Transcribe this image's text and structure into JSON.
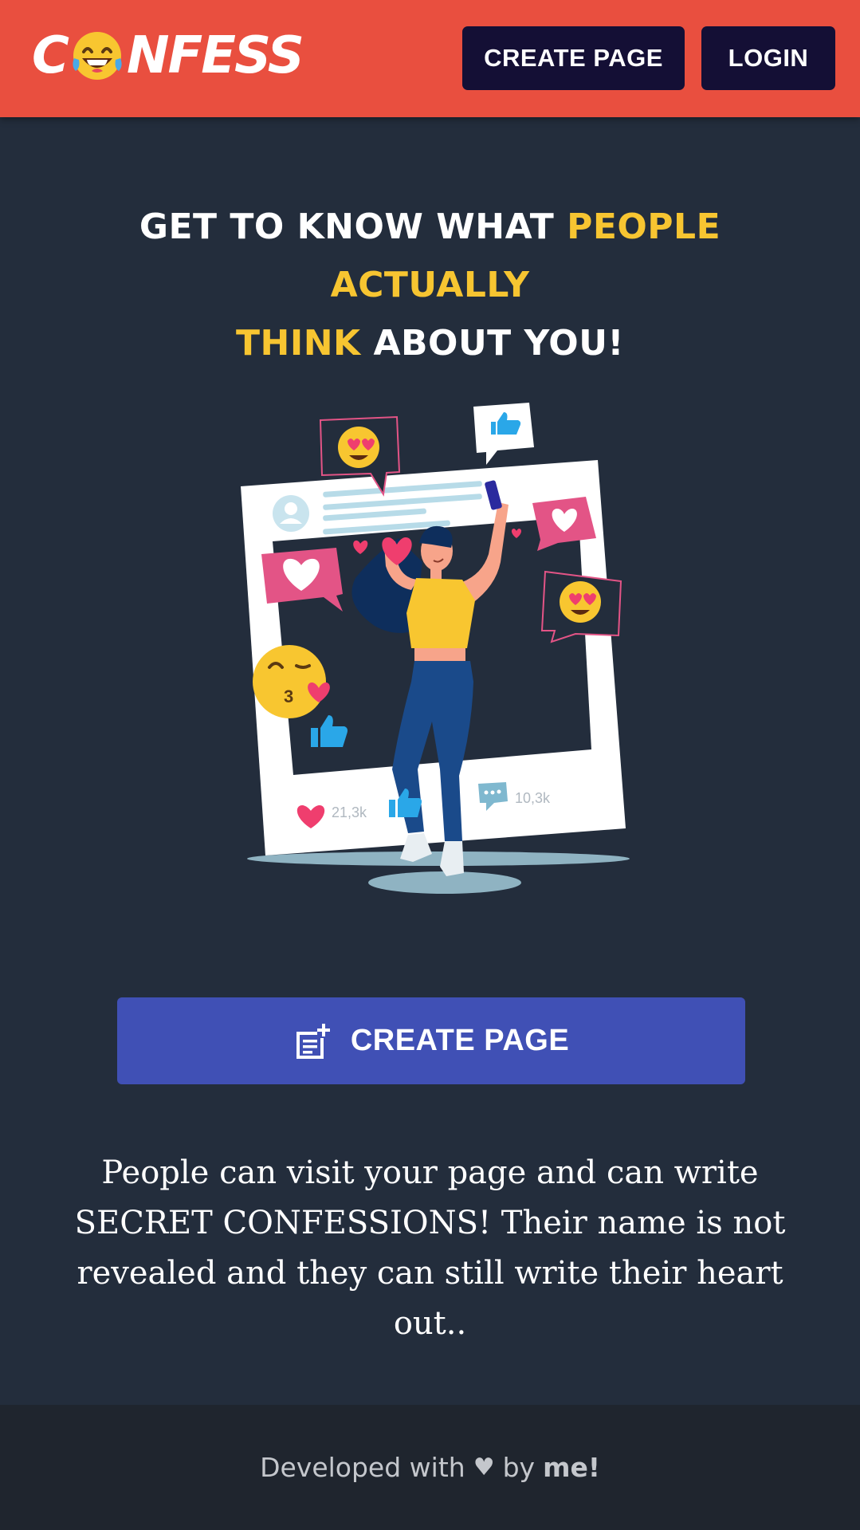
{
  "header": {
    "logo": {
      "text_start": "C",
      "text_end": "NFESS",
      "emoji": "laughing-face-icon"
    },
    "create_page_label": "CREATE PAGE",
    "login_label": "LOGIN"
  },
  "hero": {
    "headline_part1": "GET TO KNOW WHAT ",
    "headline_highlight1": "PEOPLE ACTUALLY",
    "headline_highlight2": "THINK",
    "headline_part2": " ABOUT YOU!",
    "highlight_color": "#f7c531"
  },
  "illustration": {
    "likes_count": "21,3k",
    "comments_count": "10,3k"
  },
  "cta": {
    "label": "CREATE PAGE",
    "icon": "post-add-icon"
  },
  "description": "People can visit your page and can write SECRET CONFESSIONS! Their name is not revealed and they can still write their heart out..",
  "footer": {
    "prefix": "Developed with",
    "heart": "♥",
    "by": "by",
    "author": "me!"
  },
  "colors": {
    "header_bg": "#e94f3f",
    "page_bg": "#232d3c",
    "button_dark": "#140f35",
    "button_primary": "#4050b5",
    "footer_bg": "#1f252e"
  }
}
